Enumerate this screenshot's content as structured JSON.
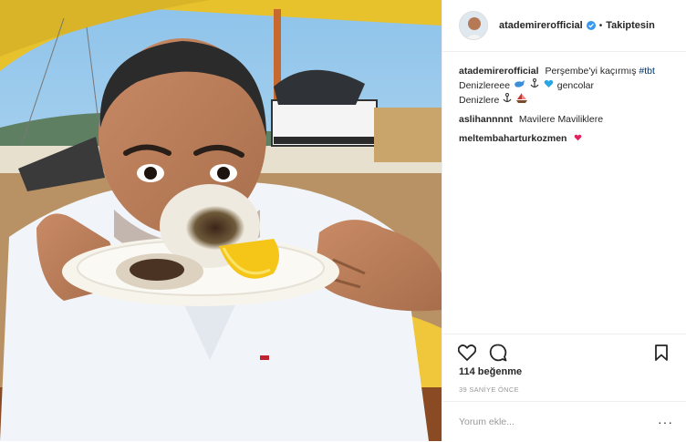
{
  "post": {
    "username": "atademirerofficial",
    "follow_status": "Takiptesin",
    "comments": [
      {
        "user": "atademirerofficial",
        "text": "Perşembe'yi kaçırmış",
        "hashtag": "#tbt",
        "line2": "Denizlereee",
        "line2b": "gencolar",
        "line3": "Denizlere"
      },
      {
        "user": "aslihannnnt",
        "text": "Mavilere Maviliklere"
      },
      {
        "user": "meltembaharturkozmen",
        "text": ""
      }
    ],
    "likes": "114 beğenme",
    "timestamp": "39 SANİYE ÖNCE",
    "comment_placeholder": "Yorum ekle...",
    "more": "···"
  },
  "icons": [
    "heart-icon",
    "comment-icon",
    "bookmark-icon",
    "verified-icon"
  ],
  "colors": {
    "verified": "#3897f0",
    "heart_emoji": "#e0245e"
  }
}
